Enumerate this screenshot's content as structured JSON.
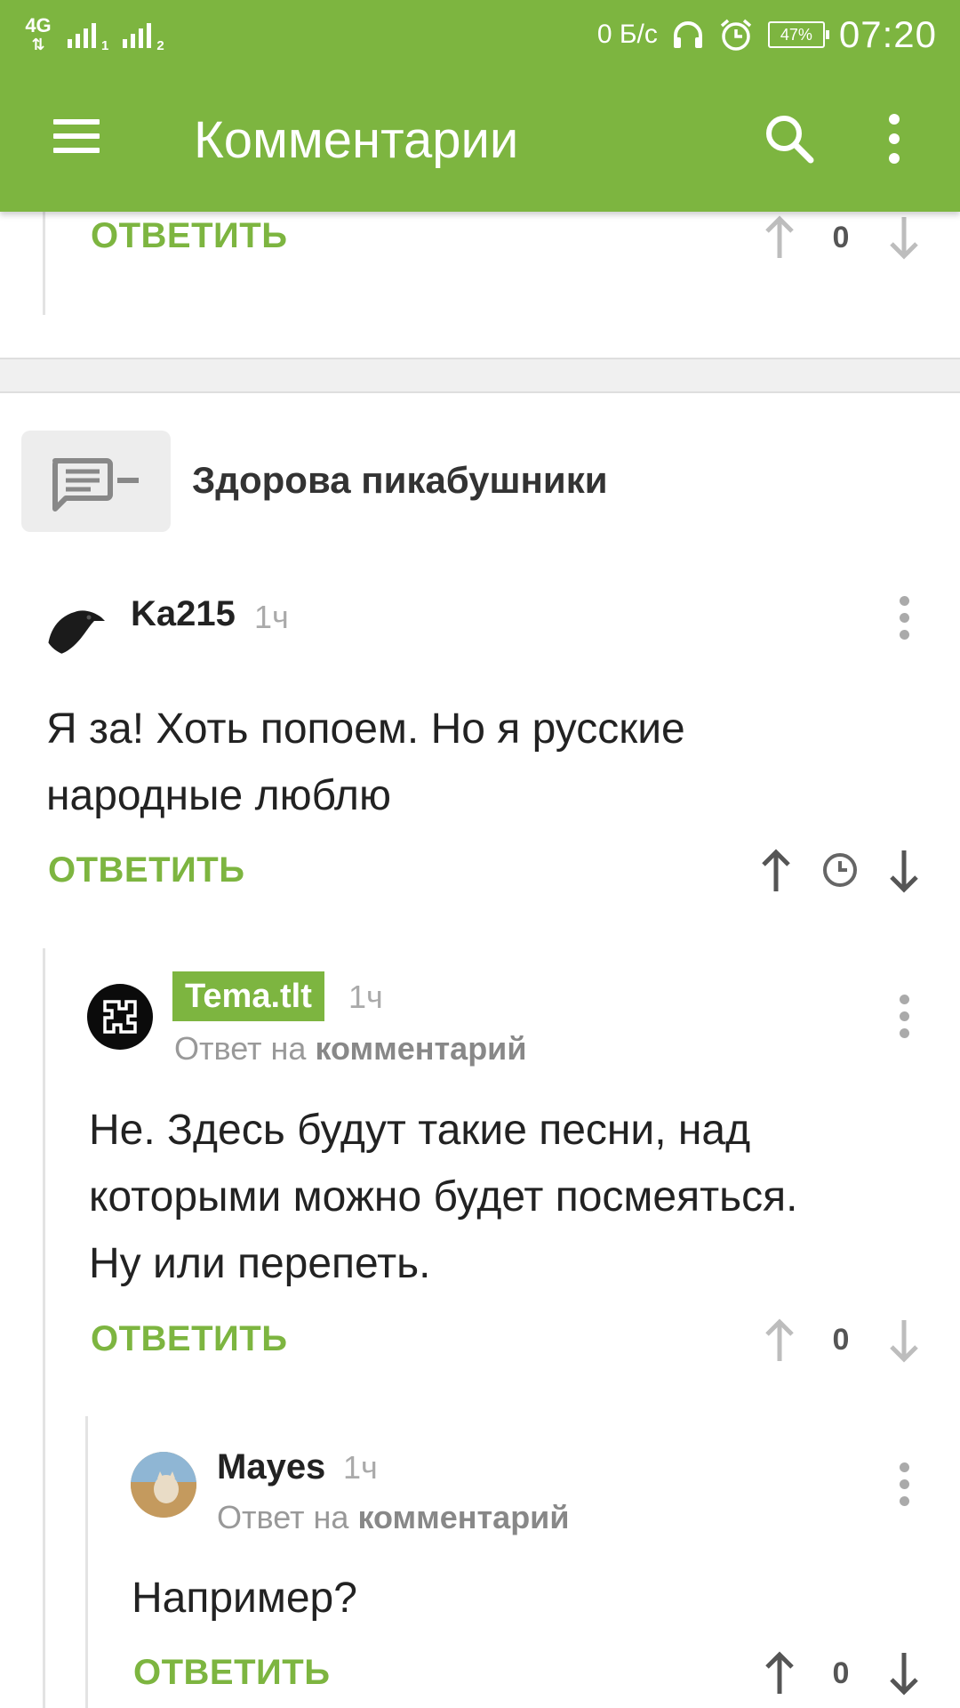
{
  "status_bar": {
    "network_type": "4G",
    "sim1": "1",
    "sim2": "2",
    "net_speed": "0 Б/с",
    "battery": "47%",
    "time": "07:20",
    "icons": [
      "signal-icon",
      "headphones-icon",
      "alarm-icon",
      "battery-icon"
    ]
  },
  "app_bar": {
    "title": "Комментарии",
    "icons": [
      "menu-icon",
      "search-icon",
      "more-vert-icon"
    ]
  },
  "colors": {
    "accent": "#7db540",
    "text": "#222222",
    "muted": "#aaaaaa"
  },
  "top_stub": {
    "reply_label": "ОТВЕТИТЬ",
    "score": "0"
  },
  "post": {
    "title": "Здорова пикабушники",
    "icon": "comment-collapse-icon"
  },
  "comments": [
    {
      "username": "Ka215",
      "time": "1ч",
      "text_line1": "Я за! Хоть попоем. Но я русские",
      "text_line2": "народные люблю",
      "reply_label": "ОТВЕТИТЬ",
      "score_icon": "clock-icon"
    },
    {
      "username": "Tema.tlt",
      "time": "1ч",
      "reply_to_prefix": "Ответ на",
      "reply_to_target": "комментарий",
      "text_line1": "Не. Здесь будут такие песни, над",
      "text_line2": "которыми можно будет посмеяться.",
      "text_line3": "Ну или перепеть.",
      "reply_label": "ОТВЕТИТЬ",
      "score": "0"
    },
    {
      "username": "Mayes",
      "time": "1ч",
      "reply_to_prefix": "Ответ на",
      "reply_to_target": "комментарий",
      "text_line1": "Например?",
      "reply_label": "ОТВЕТИТЬ",
      "score": "0"
    }
  ]
}
